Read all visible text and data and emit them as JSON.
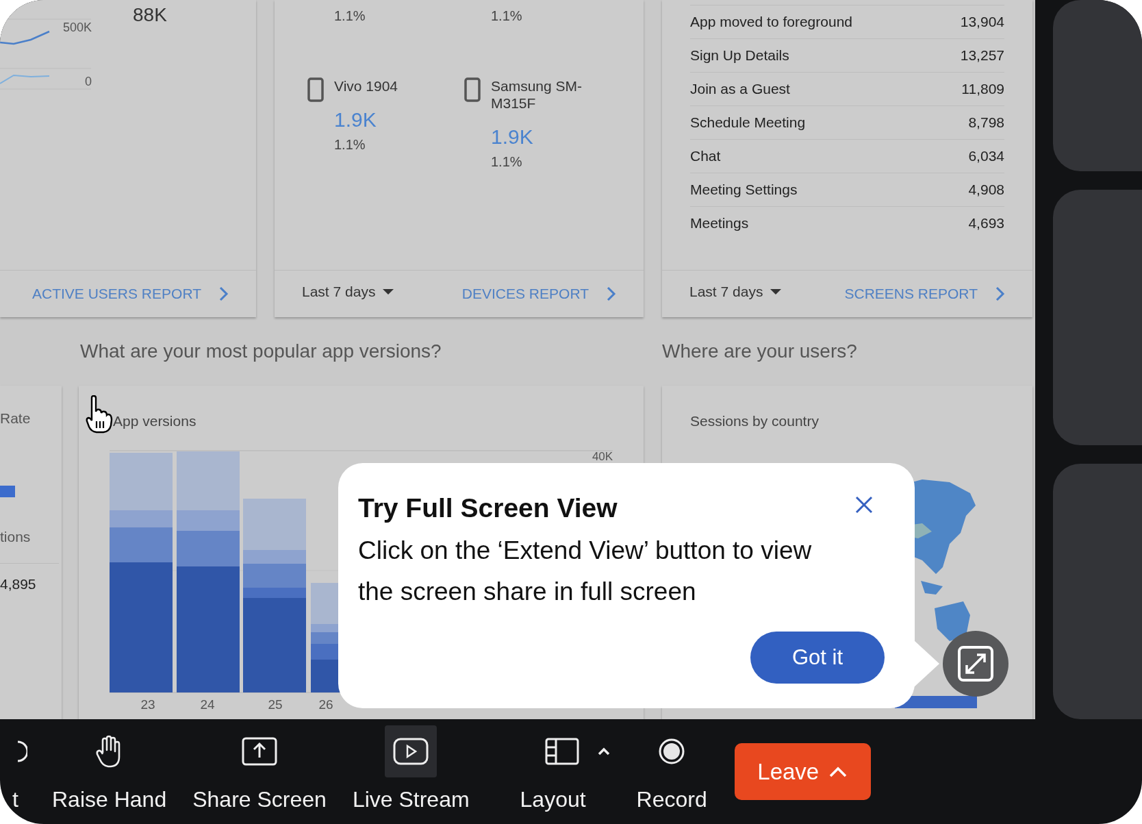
{
  "active_users_card": {
    "headline": "88K",
    "ticks": [
      "500K",
      "0"
    ],
    "report_link": "ACTIVE USERS REPORT"
  },
  "devices_card": {
    "top_shares": [
      "1.1%",
      "1.1%"
    ],
    "devices": [
      {
        "name": "Vivo 1904",
        "count": "1.9K",
        "share": "1.1%"
      },
      {
        "name": "Samsung SM-M315F",
        "count": "1.9K",
        "share": "1.1%"
      }
    ],
    "period": "Last 7 days",
    "report_link": "DEVICES REPORT"
  },
  "screens_card": {
    "rows": [
      {
        "name": "App moved to foreground",
        "count": "13,904"
      },
      {
        "name": "Sign Up Details",
        "count": "13,257"
      },
      {
        "name": "Join as a Guest",
        "count": "11,809"
      },
      {
        "name": "Schedule Meeting",
        "count": "8,798"
      },
      {
        "name": "Chat",
        "count": "6,034"
      },
      {
        "name": "Meeting Settings",
        "count": "4,908"
      },
      {
        "name": "Meetings",
        "count": "4,693"
      }
    ],
    "period": "Last 7 days",
    "report_link": "SCREENS REPORT"
  },
  "section_headings": [
    "What are your most popular app versions?",
    "Where are your users?"
  ],
  "partial_card": {
    "label_1": "Rate",
    "label_2": "tions",
    "value": "4,895"
  },
  "app_versions_card": {
    "title": "App versions",
    "y_tick": "40K",
    "x_labels": [
      "23",
      "24",
      "25",
      "26"
    ]
  },
  "sessions_card": {
    "title": "Sessions by country"
  },
  "tooltip": {
    "title": "Try Full Screen View",
    "body": "Click on the ‘Extend View’ button to view the screen share in full screen",
    "button": "Got it"
  },
  "toolbar": {
    "items": [
      {
        "label": "t",
        "kind": "partial",
        "hovered": false,
        "menu": false
      },
      {
        "label": "Raise Hand",
        "kind": "hand",
        "hovered": false,
        "menu": false
      },
      {
        "label": "Share Screen",
        "kind": "share",
        "hovered": false,
        "menu": false
      },
      {
        "label": "Live Stream",
        "kind": "stream",
        "hovered": true,
        "menu": false
      },
      {
        "label": "Layout",
        "kind": "layout",
        "hovered": false,
        "menu": true
      },
      {
        "label": "Record",
        "kind": "record",
        "hovered": false,
        "menu": false
      }
    ],
    "leave": "Leave"
  }
}
